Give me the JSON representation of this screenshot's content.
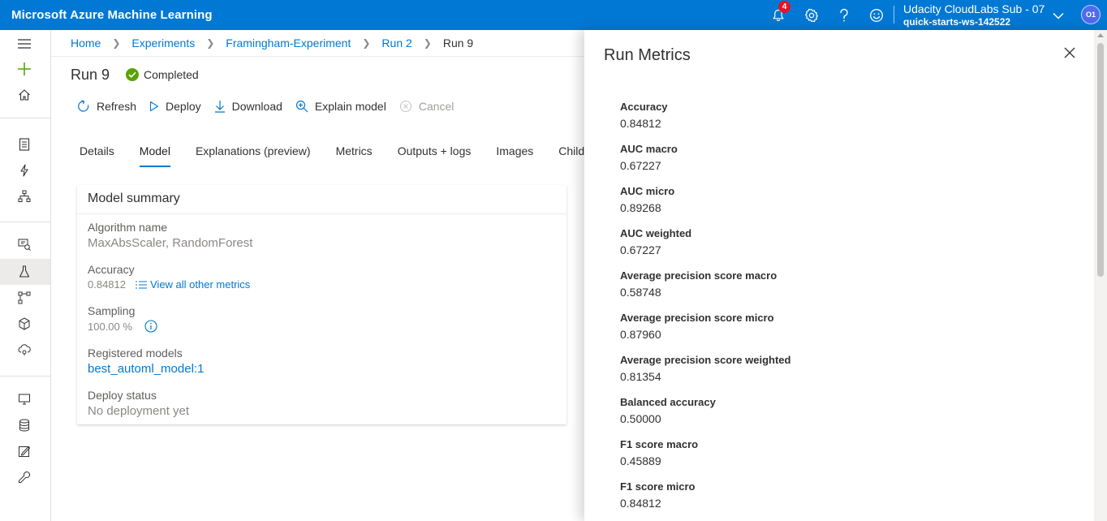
{
  "app": {
    "title": "Microsoft Azure Machine Learning",
    "notifications_count": "4",
    "subscription": "Udacity CloudLabs Sub - 07",
    "workspace": "quick-starts-ws-142522",
    "avatar_initials": "O1",
    "colors": {
      "brand": "#0078d4",
      "success": "#57a300",
      "badge": "#e81123"
    }
  },
  "breadcrumb": [
    "Home",
    "Experiments",
    "Framingham-Experiment",
    "Run 2",
    "Run 9"
  ],
  "run": {
    "title": "Run 9",
    "status": "Completed"
  },
  "toolbar": {
    "refresh": "Refresh",
    "deploy": "Deploy",
    "download": "Download",
    "explain": "Explain model",
    "cancel": "Cancel"
  },
  "tabs": [
    "Details",
    "Model",
    "Explanations (preview)",
    "Metrics",
    "Outputs + logs",
    "Images",
    "Child ru"
  ],
  "active_tab": "Model",
  "model_summary": {
    "title": "Model summary",
    "algorithm_label": "Algorithm name",
    "algorithm_value": "MaxAbsScaler, RandomForest",
    "accuracy_label": "Accuracy",
    "accuracy_value": "0.84812",
    "view_metrics_link": "View all other metrics",
    "sampling_label": "Sampling",
    "sampling_value": "100.00 %",
    "registered_label": "Registered models",
    "registered_value": "best_automl_model:1",
    "deploy_label": "Deploy status",
    "deploy_value": "No deployment yet"
  },
  "panel": {
    "title": "Run Metrics",
    "metrics": [
      {
        "label": "Accuracy",
        "value": "0.84812"
      },
      {
        "label": "AUC macro",
        "value": "0.67227"
      },
      {
        "label": "AUC micro",
        "value": "0.89268"
      },
      {
        "label": "AUC weighted",
        "value": "0.67227"
      },
      {
        "label": "Average precision score macro",
        "value": "0.58748"
      },
      {
        "label": "Average precision score micro",
        "value": "0.87960"
      },
      {
        "label": "Average precision score weighted",
        "value": "0.81354"
      },
      {
        "label": "Balanced accuracy",
        "value": "0.50000"
      },
      {
        "label": "F1 score macro",
        "value": "0.45889"
      },
      {
        "label": "F1 score micro",
        "value": "0.84812"
      }
    ]
  }
}
